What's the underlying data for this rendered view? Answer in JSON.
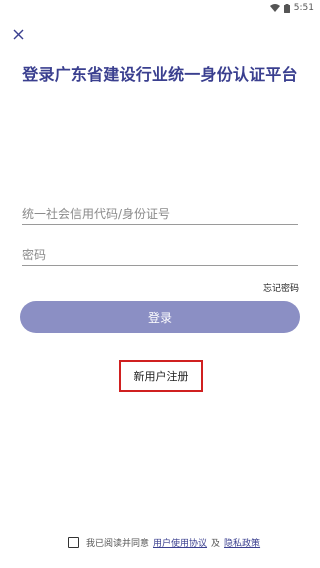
{
  "status_bar": {
    "time": "5:51",
    "icons": [
      "wifi-icon",
      "battery-icon"
    ]
  },
  "close": {
    "icon": "close-icon"
  },
  "title": "登录广东省建设行业统一身份认证平台",
  "form": {
    "id_placeholder": "统一社会信用代码/身份证号",
    "id_value": "",
    "password_placeholder": "密码",
    "password_value": ""
  },
  "forgot_password": "忘记密码",
  "login_button": "登录",
  "register_link": "新用户注册",
  "agreement": {
    "prefix": "我已阅读并同意",
    "user_agreement": "用户使用协议",
    "conjunction": "及",
    "privacy_policy": "隐私政策",
    "checked": false
  },
  "colors": {
    "title": "#3a3f8f",
    "button": "#8b8fc4",
    "highlight_border": "#d02020"
  }
}
